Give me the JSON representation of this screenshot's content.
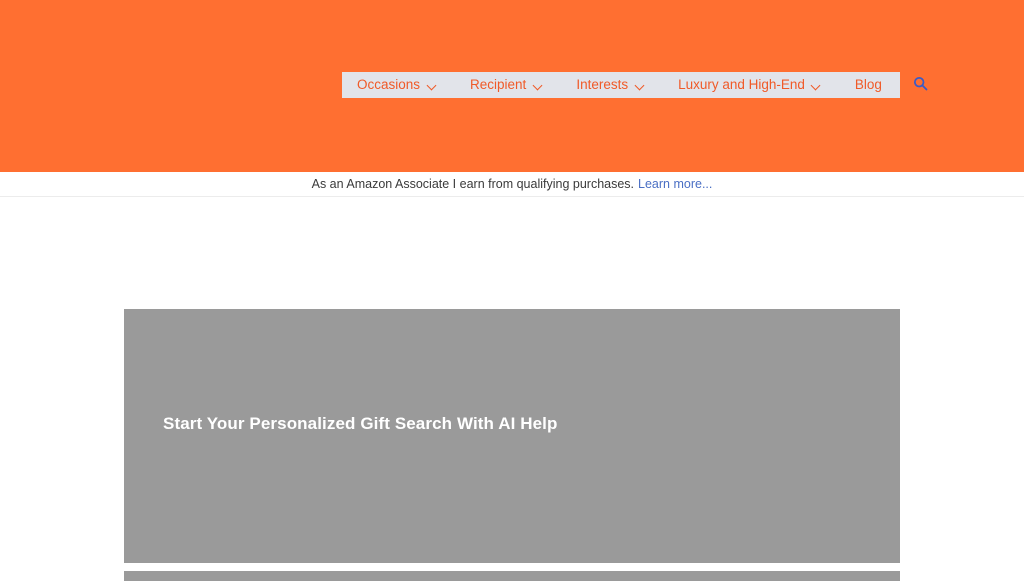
{
  "header": {
    "background_color": "#FF6F31",
    "nav": {
      "background_color": "#E2E4EA",
      "link_color": "#F05A28",
      "items": [
        {
          "label": "Occasions",
          "has_dropdown": true,
          "chevron_icon": "chevron-down-icon"
        },
        {
          "label": "Recipient",
          "has_dropdown": true,
          "chevron_icon": "chevron-down-icon"
        },
        {
          "label": "Interests",
          "has_dropdown": true,
          "chevron_icon": "chevron-down-icon"
        },
        {
          "label": "Luxury and High-End",
          "has_dropdown": true,
          "chevron_icon": "chevron-down-icon"
        },
        {
          "label": "Blog",
          "has_dropdown": false,
          "chevron_icon": ""
        }
      ]
    },
    "search": {
      "icon": "search-icon",
      "icon_color": "#3A5BC7"
    }
  },
  "notice": {
    "text": "As an Amazon Associate I earn from qualifying purchases.",
    "link_label": "Learn more...",
    "link_color": "#4A6FC4"
  },
  "main": {
    "hero": {
      "heading": "Start Your Personalized Gift Search With AI Help",
      "heading_color": "#FFFFFF",
      "placeholder_color": "#9A9A9A"
    }
  }
}
